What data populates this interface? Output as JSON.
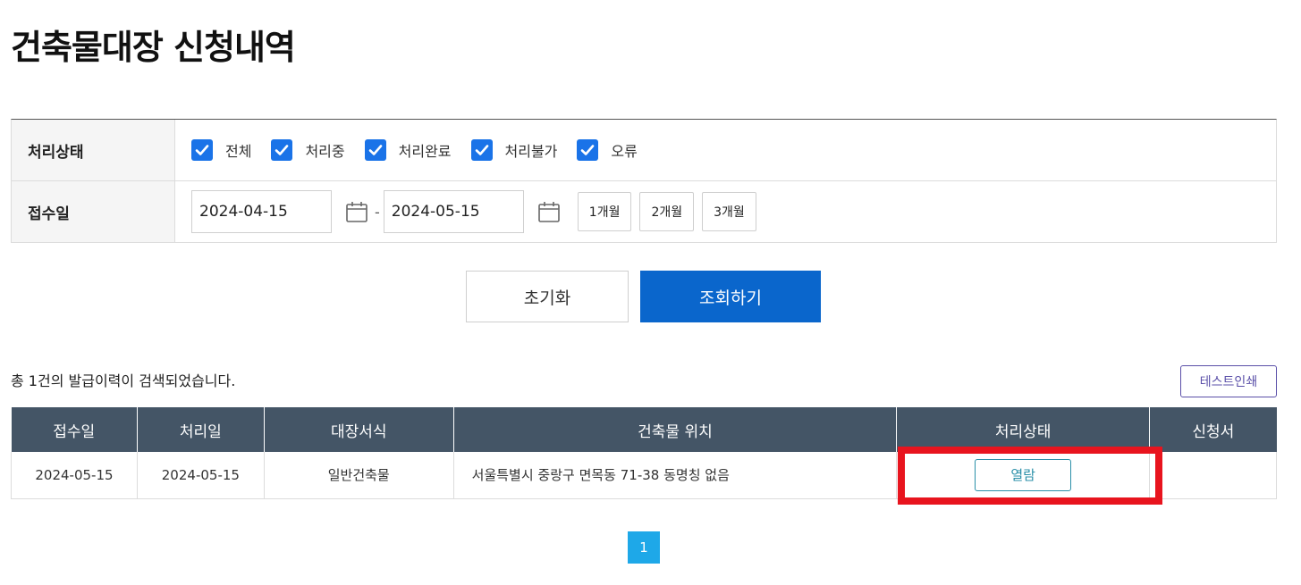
{
  "page": {
    "title": "건축물대장 신청내역"
  },
  "filters": {
    "status": {
      "label": "처리상태",
      "options": [
        {
          "label": "전체",
          "checked": true
        },
        {
          "label": "처리중",
          "checked": true
        },
        {
          "label": "처리완료",
          "checked": true
        },
        {
          "label": "처리불가",
          "checked": true
        },
        {
          "label": "오류",
          "checked": true
        }
      ]
    },
    "date": {
      "label": "접수일",
      "from": "2024-04-15",
      "separator": "-",
      "to": "2024-05-15",
      "periods": [
        "1개월",
        "2개월",
        "3개월"
      ]
    }
  },
  "actions": {
    "reset_label": "초기화",
    "search_label": "조회하기"
  },
  "results": {
    "summary": "총 1건의 발급이력이 검색되었습니다.",
    "test_print_label": "테스트인쇄",
    "columns": [
      "접수일",
      "처리일",
      "대장서식",
      "건축물 위치",
      "처리상태",
      "신청서"
    ],
    "rows": [
      {
        "received": "2024-05-15",
        "processed": "2024-05-15",
        "form": "일반건축물",
        "location": "서울특별시 중랑구 면목동 71-38 동명칭 없음",
        "status_button": "열람",
        "application": ""
      }
    ]
  },
  "pagination": {
    "current": "1"
  },
  "colors": {
    "primary": "#0a66cc",
    "header_bg": "#445566",
    "checkbox": "#1a73e8",
    "highlight": "#e8141e",
    "page_active": "#1ea8e8",
    "view_btn": "#2a8fa8",
    "test_print": "#5a4fa8"
  }
}
